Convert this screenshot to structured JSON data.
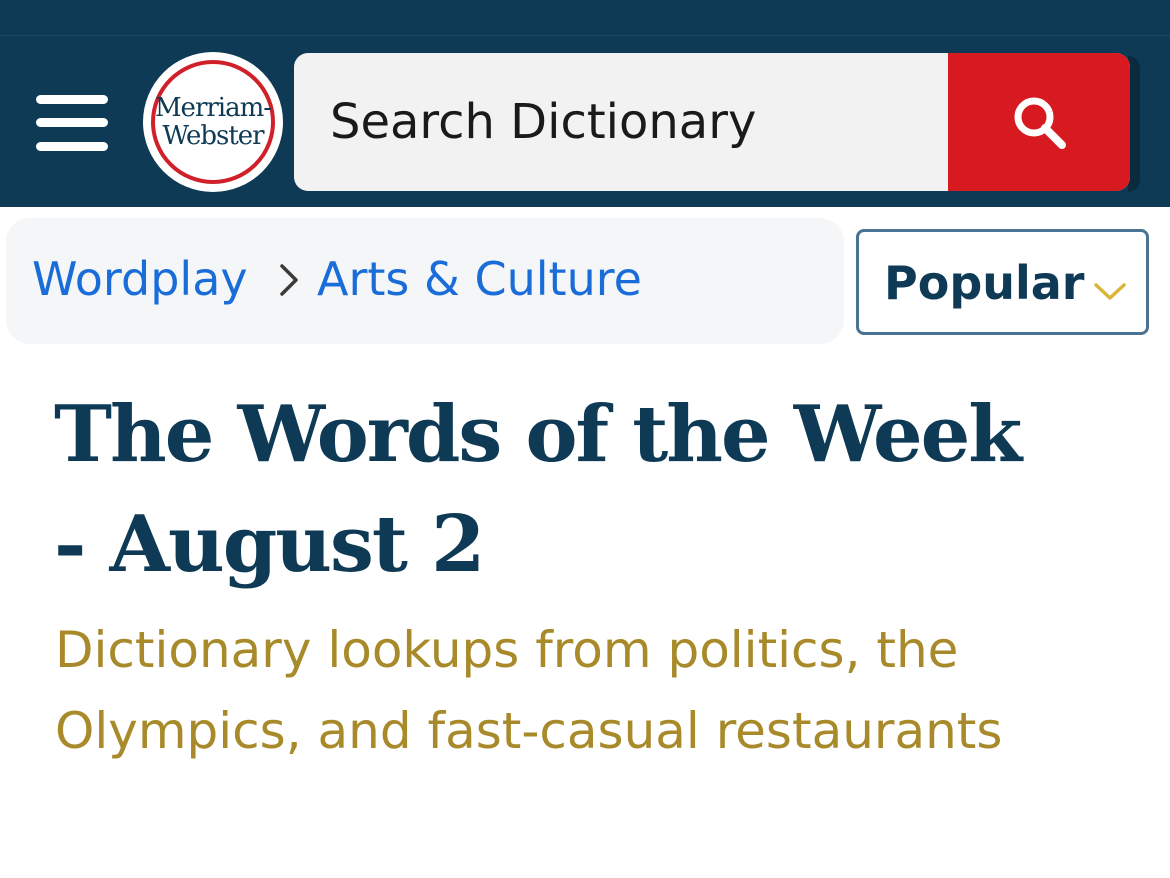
{
  "header": {
    "logo": {
      "line1": "Merriam-",
      "line2": "Webster"
    },
    "search": {
      "placeholder": "Search Dictionary"
    },
    "colors": {
      "background": "#0f3a55",
      "search_button": "#d71920"
    }
  },
  "breadcrumb": {
    "items": [
      {
        "label": "Wordplay"
      },
      {
        "label": "Arts & Culture"
      }
    ]
  },
  "sort": {
    "selected": "Popular"
  },
  "article": {
    "title": "The Words of the Week - August 2",
    "subtitle": "Dictionary lookups from politics, the Olympics, and fast-casual restaurants"
  },
  "icons": {
    "menu": "hamburger-menu-icon",
    "search": "search-icon",
    "breadcrumb_separator": "chevron-right-icon",
    "dropdown": "chevron-down-icon"
  }
}
